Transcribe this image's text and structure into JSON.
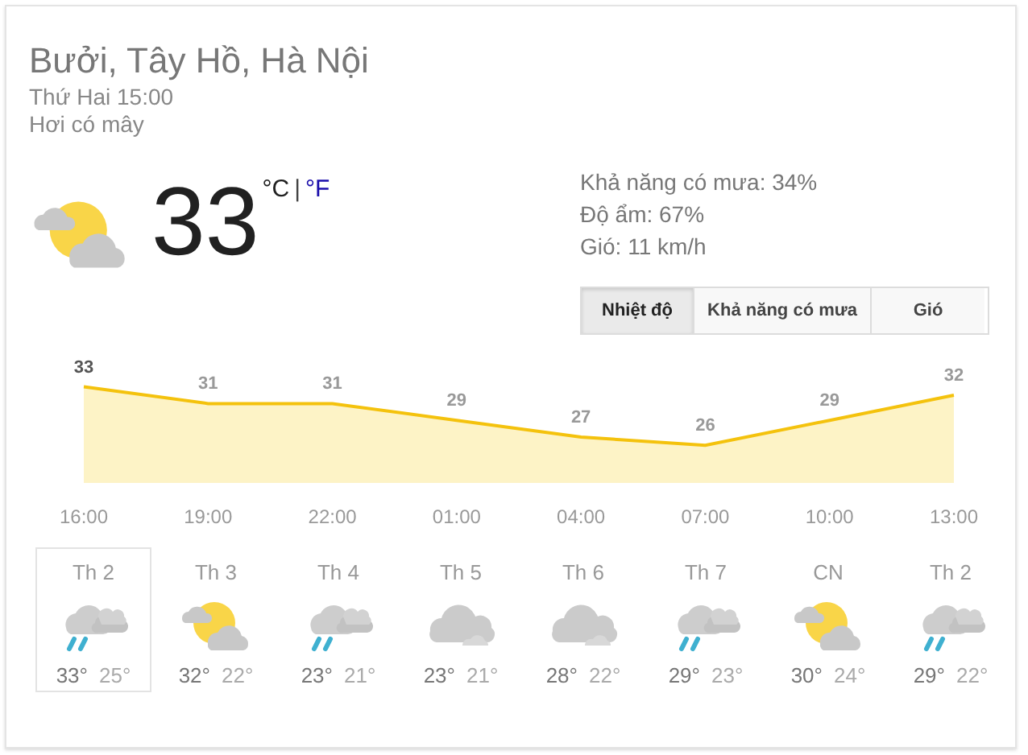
{
  "location": "Bưởi, Tây Hồ, Hà Nội",
  "datetime": "Thứ Hai 15:00",
  "condition": "Hơi có mây",
  "current": {
    "kind": "partly",
    "temperature": "33",
    "units": [
      {
        "label": "°C",
        "selected": true
      },
      {
        "label": "°F",
        "selected": false
      }
    ],
    "separator": "|"
  },
  "details": [
    "Khả năng có mưa: 34%",
    "Độ ẩm: 67%",
    "Gió: 11 km/h"
  ],
  "tabs": [
    {
      "label": "Nhiệt độ",
      "selected": true
    },
    {
      "label": "Khả năng có mưa",
      "selected": false
    },
    {
      "label": "Gió",
      "selected": false
    }
  ],
  "chart_data": {
    "type": "area",
    "categories": [
      "16:00",
      "19:00",
      "22:00",
      "01:00",
      "04:00",
      "07:00",
      "10:00",
      "13:00"
    ],
    "values": [
      33,
      31,
      31,
      29,
      27,
      26,
      29,
      32
    ],
    "data_labels": true
  },
  "days": [
    {
      "day": "Th 2",
      "kind": "rain",
      "high": "33°",
      "low": "25°",
      "selected": true
    },
    {
      "day": "Th 3",
      "kind": "partly",
      "high": "32°",
      "low": "22°",
      "selected": false
    },
    {
      "day": "Th 4",
      "kind": "rain",
      "high": "23°",
      "low": "21°",
      "selected": false
    },
    {
      "day": "Th 5",
      "kind": "cloudy",
      "high": "23°",
      "low": "21°",
      "selected": false
    },
    {
      "day": "Th 6",
      "kind": "cloudy",
      "high": "28°",
      "low": "22°",
      "selected": false
    },
    {
      "day": "Th 7",
      "kind": "rain",
      "high": "29°",
      "low": "23°",
      "selected": false
    },
    {
      "day": "CN",
      "kind": "partly",
      "high": "30°",
      "low": "24°",
      "selected": false
    },
    {
      "day": "Th 2",
      "kind": "rain",
      "high": "29°",
      "low": "22°",
      "selected": false
    }
  ]
}
